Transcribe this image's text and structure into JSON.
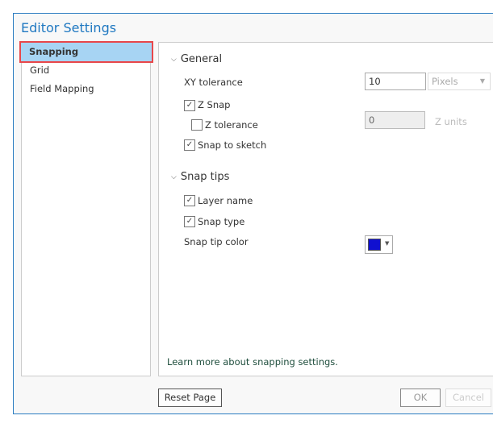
{
  "dialog": {
    "title": "Editor Settings"
  },
  "nav": {
    "items": [
      {
        "label": "Snapping",
        "selected": true
      },
      {
        "label": "Grid"
      },
      {
        "label": "Field Mapping"
      }
    ]
  },
  "general": {
    "header": "General",
    "xy_tolerance_label": "XY tolerance",
    "xy_tolerance_value": "10",
    "xy_units": "Pixels",
    "z_snap": {
      "label": "Z Snap",
      "checked": true
    },
    "z_tolerance": {
      "label": "Z tolerance",
      "checked": false,
      "value": "0",
      "units": "Z units"
    },
    "snap_to_sketch": {
      "label": "Snap to sketch",
      "checked": true
    }
  },
  "snap_tips": {
    "header": "Snap tips",
    "layer_name": {
      "label": "Layer name",
      "checked": true
    },
    "snap_type": {
      "label": "Snap type",
      "checked": true
    },
    "color_label": "Snap tip color",
    "color": "#1010d0"
  },
  "link": "Learn more about snapping settings.",
  "buttons": {
    "reset": "Reset Page",
    "ok": "OK",
    "cancel": "Cancel"
  }
}
